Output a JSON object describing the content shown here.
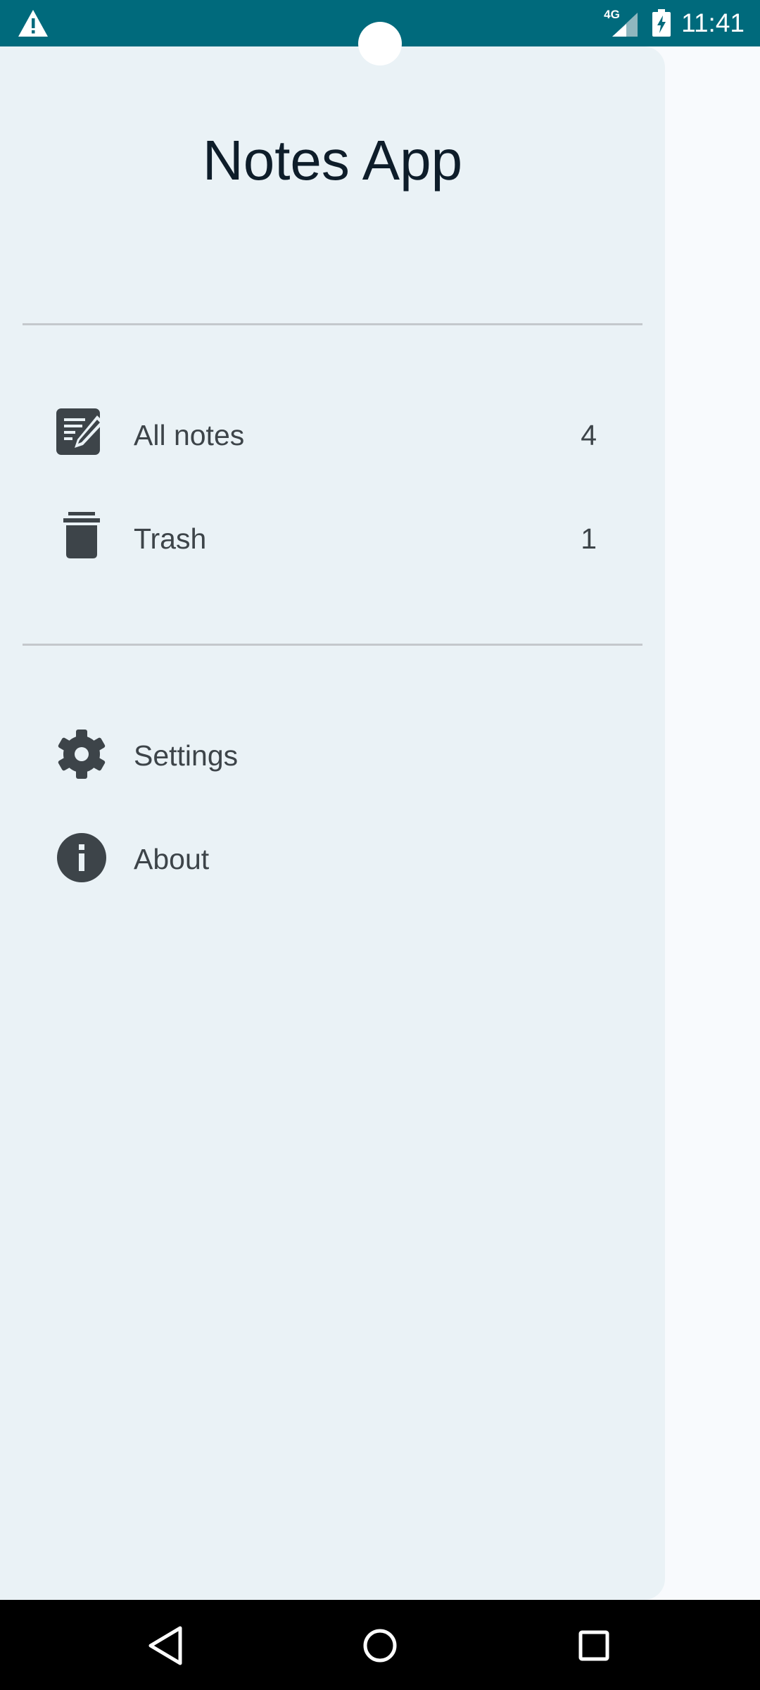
{
  "status_bar": {
    "warning_icon": "warning-icon",
    "network_label": "4G",
    "signal_icon": "signal-icon",
    "battery_icon": "battery-charging-icon",
    "time": "11:41",
    "background_color": "#006a7c"
  },
  "drawer": {
    "title": "Notes App",
    "background_color": "#eaf2f6",
    "primary_items": [
      {
        "label": "All notes",
        "count": "4",
        "icon": "edit-note-icon"
      },
      {
        "label": "Trash",
        "count": "1",
        "icon": "trash-icon"
      }
    ],
    "secondary_items": [
      {
        "label": "Settings",
        "icon": "settings-icon"
      },
      {
        "label": "About",
        "icon": "info-icon"
      }
    ],
    "icon_color": "#3d4449"
  },
  "navigation_bar": {
    "back_icon": "back-triangle-icon",
    "home_icon": "home-circle-icon",
    "recents_icon": "recents-square-icon"
  }
}
